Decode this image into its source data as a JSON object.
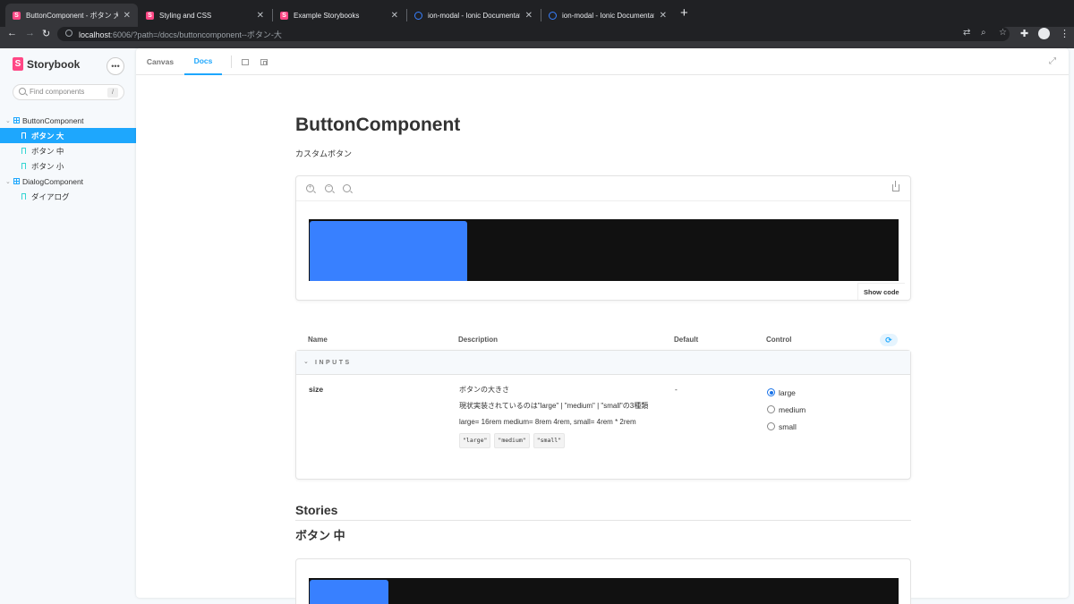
{
  "browser": {
    "tabs": [
      {
        "title": "ButtonComponent - ボタン 大",
        "favicon": "storybook-icon",
        "active": true
      },
      {
        "title": "Styling and CSS",
        "favicon": "storybook-icon",
        "active": false
      },
      {
        "title": "Example Storybooks",
        "favicon": "storybook-icon",
        "active": false
      },
      {
        "title": "ion-modal - Ionic Documentation",
        "favicon": "ionic-icon",
        "active": false
      },
      {
        "title": "ion-modal - Ionic Documentation",
        "favicon": "ionic-icon",
        "active": false
      }
    ],
    "url_host": "localhost",
    "url_rest": ":6006/?path=/docs/buttoncomponent--ボタン-大"
  },
  "sidebar": {
    "brand": "Storybook",
    "search_placeholder": "Find components",
    "search_shortcut": "/",
    "tree": [
      {
        "label": "ButtonComponent",
        "kind": "component"
      },
      {
        "label": "ボタン 大",
        "kind": "story",
        "selected": true
      },
      {
        "label": "ボタン 中",
        "kind": "story"
      },
      {
        "label": "ボタン 小",
        "kind": "story"
      },
      {
        "label": "DialogComponent",
        "kind": "component"
      },
      {
        "label": "ダイアログ",
        "kind": "story"
      }
    ]
  },
  "toolbar": {
    "canvas_tab": "Canvas",
    "docs_tab": "Docs"
  },
  "docs": {
    "title": "ButtonComponent",
    "description": "カスタムボタン",
    "show_code": "Show code",
    "args_table": {
      "headers": {
        "name": "Name",
        "description": "Description",
        "default": "Default",
        "control": "Control"
      },
      "section": "INPUTS",
      "prop": {
        "name": "size",
        "desc_1": "ボタンの大きさ",
        "desc_2": "現状実装されているのは\"large\" | \"medium\" | \"small\"の3種類",
        "desc_3": "large= 16rem medium= 8rem 4rem, small= 4rem * 2rem",
        "codes": [
          "\"large\"",
          "\"medium\"",
          "\"small\""
        ],
        "default": "-",
        "options": [
          "large",
          "medium",
          "small"
        ],
        "selected": "large"
      }
    },
    "stories_heading": "Stories",
    "story_heading": "ボタン 中"
  },
  "colors": {
    "accent": "#1ea7fd",
    "brand": "#ff4785",
    "ionic_primary": "#3880ff"
  }
}
